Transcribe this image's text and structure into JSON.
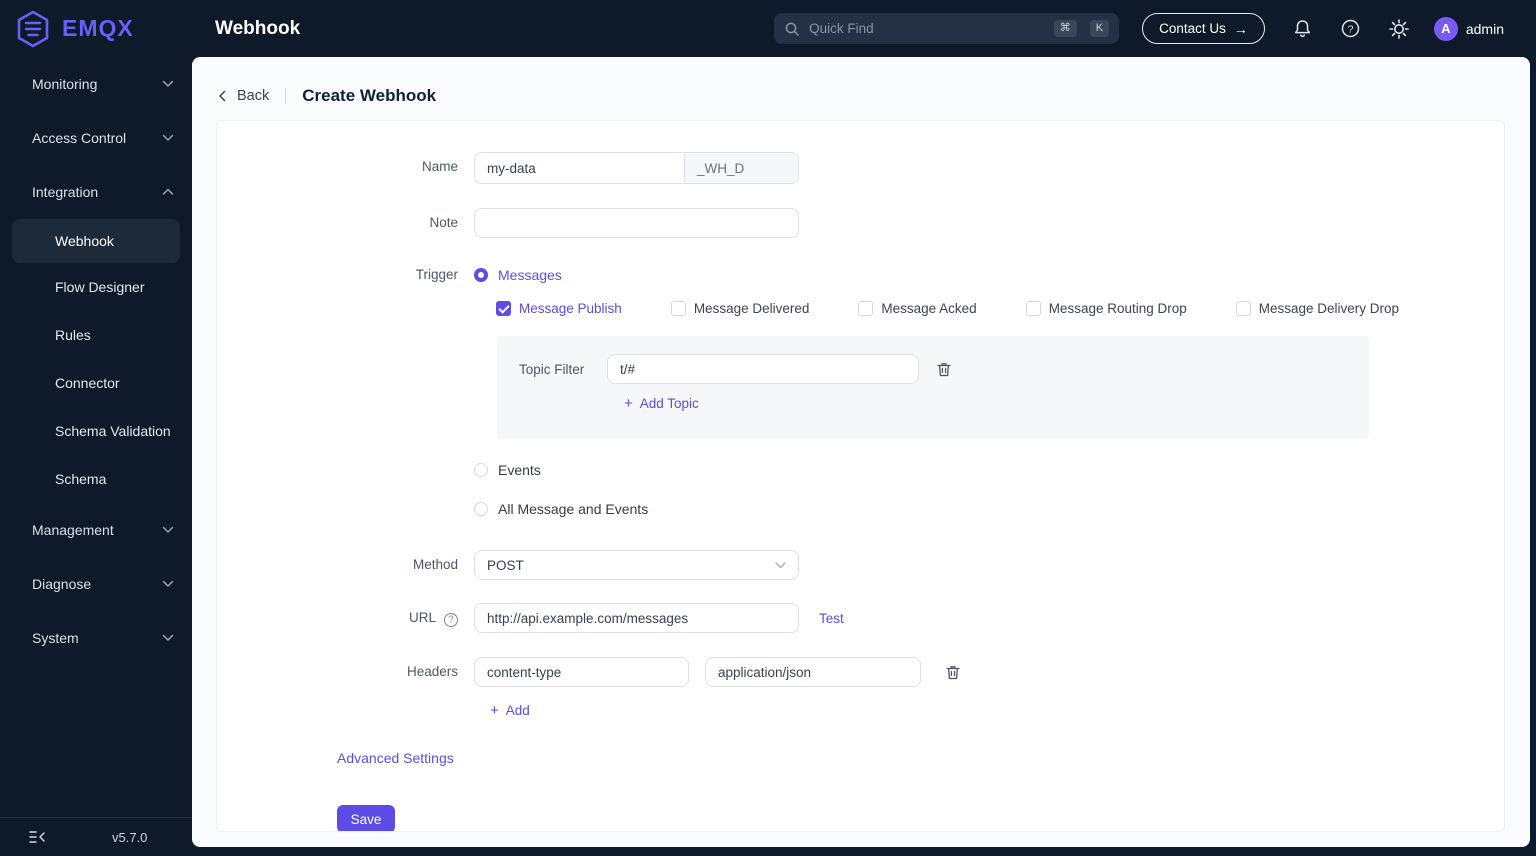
{
  "header": {
    "brand": "EMQX",
    "page_title": "Webhook",
    "search": {
      "placeholder": "Quick Find",
      "shortcut_keys": [
        "⌘",
        "K"
      ]
    },
    "contact_button": "Contact Us",
    "user": {
      "avatar_initial": "A",
      "name": "admin"
    }
  },
  "sidebar": {
    "items": [
      {
        "label": "Monitoring",
        "state": "collapsed"
      },
      {
        "label": "Access Control",
        "state": "collapsed"
      },
      {
        "label": "Integration",
        "state": "expanded",
        "children": [
          {
            "label": "Webhook",
            "active": true
          },
          {
            "label": "Flow Designer"
          },
          {
            "label": "Rules"
          },
          {
            "label": "Connector"
          },
          {
            "label": "Schema Validation"
          },
          {
            "label": "Schema"
          }
        ]
      },
      {
        "label": "Management",
        "state": "collapsed"
      },
      {
        "label": "Diagnose",
        "state": "collapsed"
      },
      {
        "label": "System",
        "state": "collapsed"
      }
    ],
    "version": "v5.7.0"
  },
  "main": {
    "back_label": "Back",
    "title": "Create Webhook",
    "form": {
      "name": {
        "label": "Name",
        "value": "my-data",
        "suffix": "_WH_D"
      },
      "note": {
        "label": "Note",
        "value": ""
      },
      "trigger": {
        "label": "Trigger",
        "options": [
          {
            "label": "Messages",
            "selected": true
          },
          {
            "label": "Events",
            "selected": false
          },
          {
            "label": "All Message and Events",
            "selected": false
          }
        ],
        "message_types": [
          {
            "label": "Message Publish",
            "checked": true
          },
          {
            "label": "Message Delivered",
            "checked": false
          },
          {
            "label": "Message Acked",
            "checked": false
          },
          {
            "label": "Message Routing Drop",
            "checked": false
          },
          {
            "label": "Message Delivery Drop",
            "checked": false
          }
        ],
        "topic_filter": {
          "label": "Topic Filter",
          "value": "t/#",
          "add_label": "Add Topic"
        }
      },
      "method": {
        "label": "Method",
        "value": "POST"
      },
      "url": {
        "label": "URL",
        "value": "http://api.example.com/messages",
        "test_label": "Test"
      },
      "headers": {
        "label": "Headers",
        "key": "content-type",
        "value": "application/json",
        "add_label": "Add"
      },
      "advanced_settings_label": "Advanced Settings",
      "save_label": "Save"
    }
  },
  "icons": {
    "logo": "emqx-hexagon",
    "search": "magnifier",
    "contact_arrow": "arrow-right",
    "notifications": "bell",
    "help": "question-circle",
    "settings": "gear",
    "group_toggle": "chevron-down",
    "back": "chevron-left",
    "delete": "trash",
    "add": "plus",
    "url_help": "question-circle",
    "method_dropdown": "chevron-down",
    "collapse_sidebar": "collapse-left"
  },
  "colors": {
    "accent": "#5e4be6",
    "dark_bg": "#0e1a29",
    "active_item_bg": "#1d2a3a",
    "avatar_bg": "#7a5af5",
    "panel_bg": "#fafbfc",
    "card_bg": "#ffffff"
  }
}
